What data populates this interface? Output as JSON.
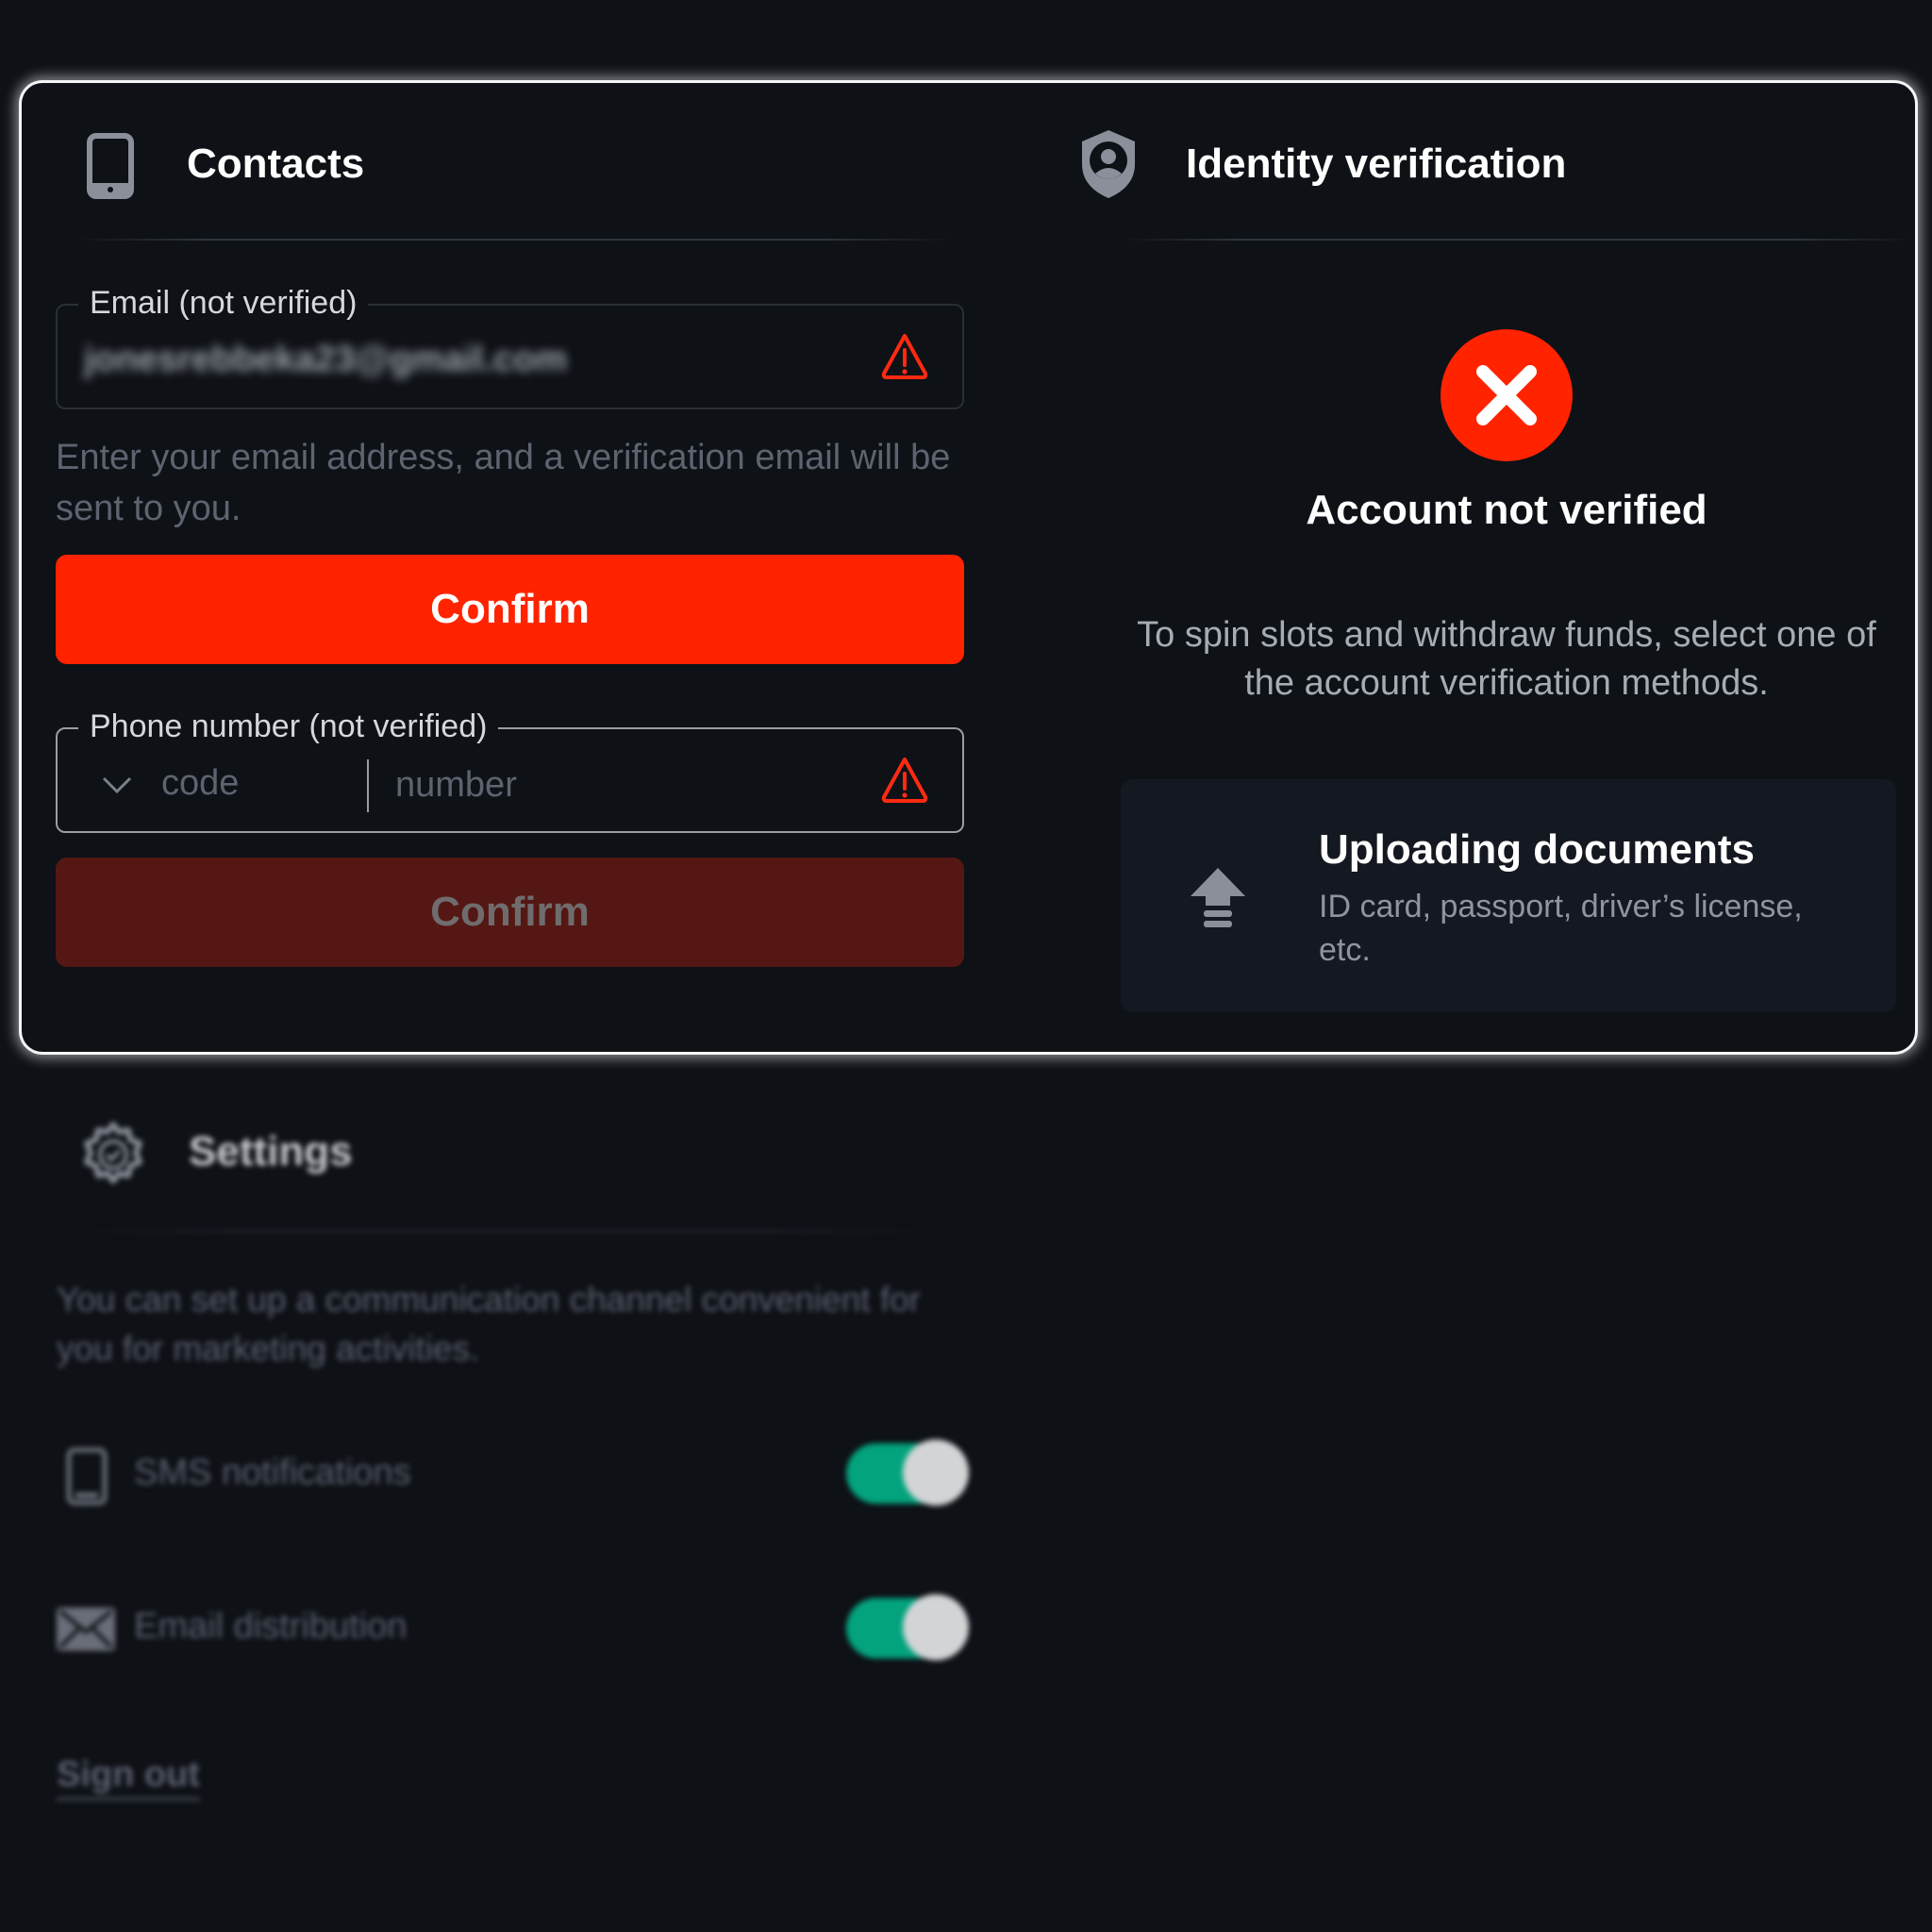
{
  "contacts": {
    "title": "Contacts",
    "email": {
      "label": "Email (not verified)",
      "value": "jonesrebbeka23@gmail.com",
      "status_icon": "warning-icon"
    },
    "email_help": "Enter your email address, and a verification email will be sent to you.",
    "email_confirm_label": "Confirm",
    "phone": {
      "label": "Phone number (not verified)",
      "code_placeholder": "code",
      "number_placeholder": "number",
      "status_icon": "warning-icon"
    },
    "phone_confirm_label": "Confirm"
  },
  "identity": {
    "title": "Identity verification",
    "status_title": "Account not verified",
    "status_desc": "To spin slots and withdraw funds, select one of the account verification methods.",
    "methods": [
      {
        "title": "Uploading documents",
        "description": "ID card, passport, driver’s license, etc.",
        "icon": "upload-icon"
      }
    ]
  },
  "settings": {
    "title": "Settings",
    "description": "You can set up a communication channel convenient for you for marketing activities.",
    "items": [
      {
        "label": "SMS notifications",
        "icon": "phone-icon",
        "enabled": true
      },
      {
        "label": "Email distribution",
        "icon": "envelope-icon",
        "enabled": true
      }
    ],
    "sign_out_label": "Sign out"
  },
  "colors": {
    "accent": "#ff2300",
    "disabled_button": "#551714",
    "toggle_on": "#03a37e",
    "background": "#0e1116"
  }
}
